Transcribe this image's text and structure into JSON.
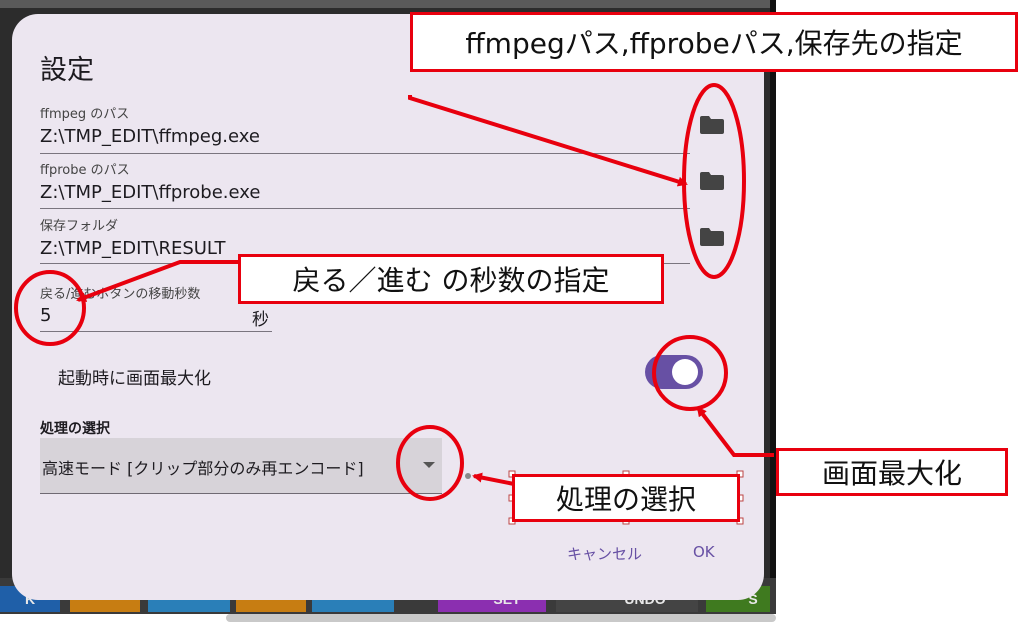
{
  "dialog": {
    "title": "設定",
    "ffmpeg": {
      "label": "ffmpeg のパス",
      "value": "Z:\\TMP_EDIT\\ffmpeg.exe"
    },
    "ffprobe": {
      "label": "ffprobe のパス",
      "value": "Z:\\TMP_EDIT\\ffprobe.exe"
    },
    "output": {
      "label": "保存フォルダ",
      "value": "Z:\\TMP_EDIT\\RESULT"
    },
    "seek": {
      "label": "戻る/進むボタンの移動秒数",
      "value": "5",
      "unit": "秒"
    },
    "maximize": {
      "label": "起動時に画面最大化",
      "on": true
    },
    "process": {
      "label": "処理の選択",
      "value": "高速モード [クリップ部分のみ再エンコード]"
    },
    "cancel_label": "キャンセル",
    "ok_label": "OK"
  },
  "background": {
    "buttons": [
      "K",
      "SET",
      "UNDO",
      "S"
    ]
  },
  "annotations": {
    "paths": "ffmpegパス,ffprobeパス,保存先の指定",
    "seek": "戻る／進む の秒数の指定",
    "maximize": "画面最大化",
    "process": "処理の選択"
  },
  "colors": {
    "accent": "#6750a4",
    "annotation": "#e8000e",
    "dialog_bg": "#ece6f0"
  }
}
